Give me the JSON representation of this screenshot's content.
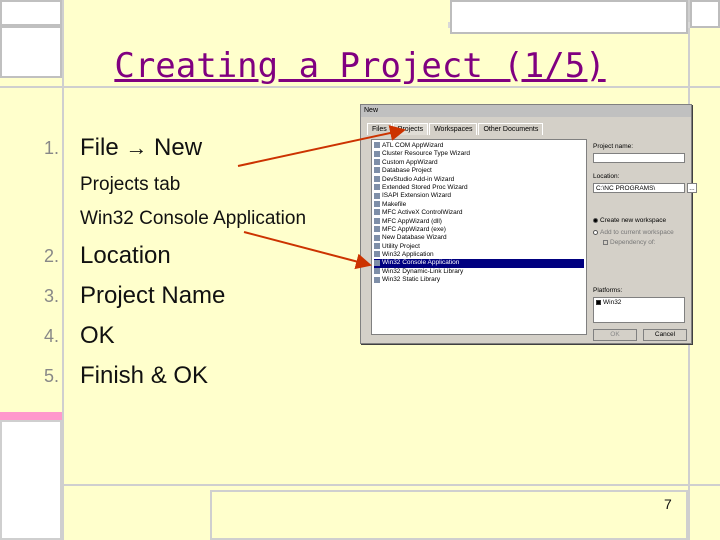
{
  "slide": {
    "title": "Creating a Project (1/5)",
    "page_number": "7",
    "steps": [
      {
        "num": "1.",
        "text": "File",
        "arrow": "→",
        "text2": "New"
      },
      {
        "num": "2.",
        "text": "Location"
      },
      {
        "num": "3.",
        "text": "Project Name"
      },
      {
        "num": "4.",
        "text": "OK"
      },
      {
        "num": "5.",
        "text": "Finish & OK"
      }
    ],
    "substeps": [
      "Projects tab",
      "Win32 Console Application"
    ]
  },
  "dialog": {
    "title": "New",
    "tabs": [
      "Files",
      "Projects",
      "Workspaces",
      "Other Documents"
    ],
    "projects": [
      "ATL COM AppWizard",
      "Cluster Resource Type Wizard",
      "Custom AppWizard",
      "Database Project",
      "DevStudio Add-in Wizard",
      "Extended Stored Proc Wizard",
      "ISAPI Extension Wizard",
      "Makefile",
      "MFC ActiveX ControlWizard",
      "MFC AppWizard (dll)",
      "MFC AppWizard (exe)",
      "New Database Wizard",
      "Utility Project",
      "Win32 Application",
      "Win32 Console Application",
      "Win32 Dynamic-Link Library",
      "Win32 Static Library"
    ],
    "selected_project": "Win32 Console Application",
    "project_name_label": "Project name:",
    "project_name_value": "",
    "location_label": "Location:",
    "location_value": "C:\\NC PROGRAMS\\",
    "browse_label": "...",
    "radio_create": "Create new workspace",
    "radio_add": "Add to current workspace",
    "dependency_label": "Dependency of:",
    "platforms_label": "Platforms:",
    "platform_value": "Win32",
    "ok_label": "OK",
    "cancel_label": "Cancel"
  },
  "colors": {
    "title": "#800080",
    "background": "#ffffcc",
    "arrow": "#cc3300",
    "selection": "#000080"
  }
}
